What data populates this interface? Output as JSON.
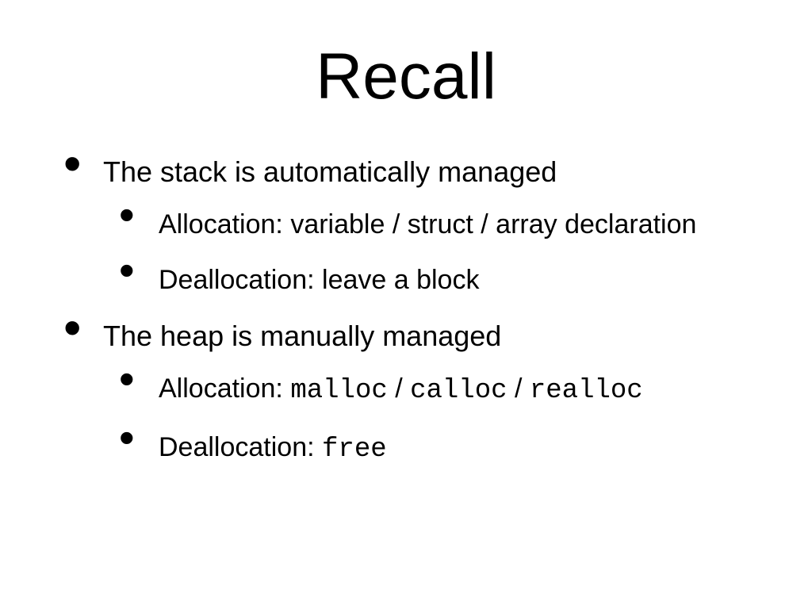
{
  "title": "Recall",
  "bullets": {
    "b1": "The stack is automatically managed",
    "b1_1": "Allocation: variable / struct / array declaration",
    "b1_2": "Deallocation: leave a block",
    "b2": "The heap is manually managed",
    "b2_1_prefix": "Allocation: ",
    "b2_1_code1": "malloc",
    "b2_1_sep1": " / ",
    "b2_1_code2": "calloc",
    "b2_1_sep2": " / ",
    "b2_1_code3": "realloc",
    "b2_2_prefix": "Deallocation: ",
    "b2_2_code": "free"
  }
}
